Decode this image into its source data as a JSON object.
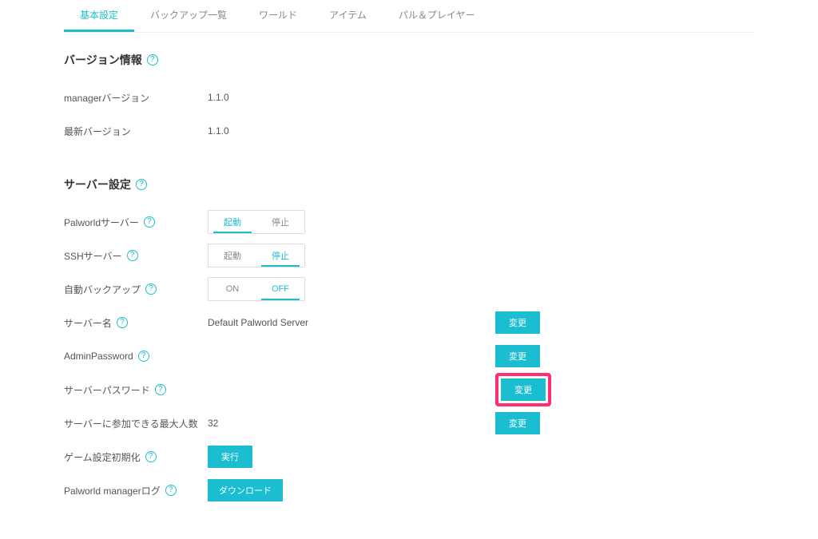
{
  "tabs": [
    {
      "label": "基本設定",
      "active": true
    },
    {
      "label": "バックアップ一覧",
      "active": false
    },
    {
      "label": "ワールド",
      "active": false
    },
    {
      "label": "アイテム",
      "active": false
    },
    {
      "label": "パル＆プレイヤー",
      "active": false
    }
  ],
  "version": {
    "title": "バージョン情報",
    "rows": {
      "manager": {
        "label": "managerバージョン",
        "value": "1.1.0"
      },
      "latest": {
        "label": "最新バージョン",
        "value": "1.1.0"
      }
    }
  },
  "server": {
    "title": "サーバー設定",
    "palworld": {
      "label": "Palworldサーバー",
      "start": "起動",
      "stop": "停止",
      "active": "start"
    },
    "ssh": {
      "label": "SSHサーバー",
      "start": "起動",
      "stop": "停止",
      "active": "stop"
    },
    "autobackup": {
      "label": "自動バックアップ",
      "on": "ON",
      "off": "OFF",
      "active": "off"
    },
    "name": {
      "label": "サーバー名",
      "value": "Default Palworld Server",
      "action": "変更"
    },
    "adminpw": {
      "label": "AdminPassword",
      "value": "",
      "action": "変更"
    },
    "serverpw": {
      "label": "サーバーパスワード",
      "value": "",
      "action": "変更"
    },
    "maxplayers": {
      "label": "サーバーに参加できる最大人数",
      "value": "32",
      "action": "変更"
    },
    "resetgame": {
      "label": "ゲーム設定初期化",
      "action": "実行"
    },
    "managerlog": {
      "label": "Palworld managerログ",
      "action": "ダウンロード"
    }
  }
}
